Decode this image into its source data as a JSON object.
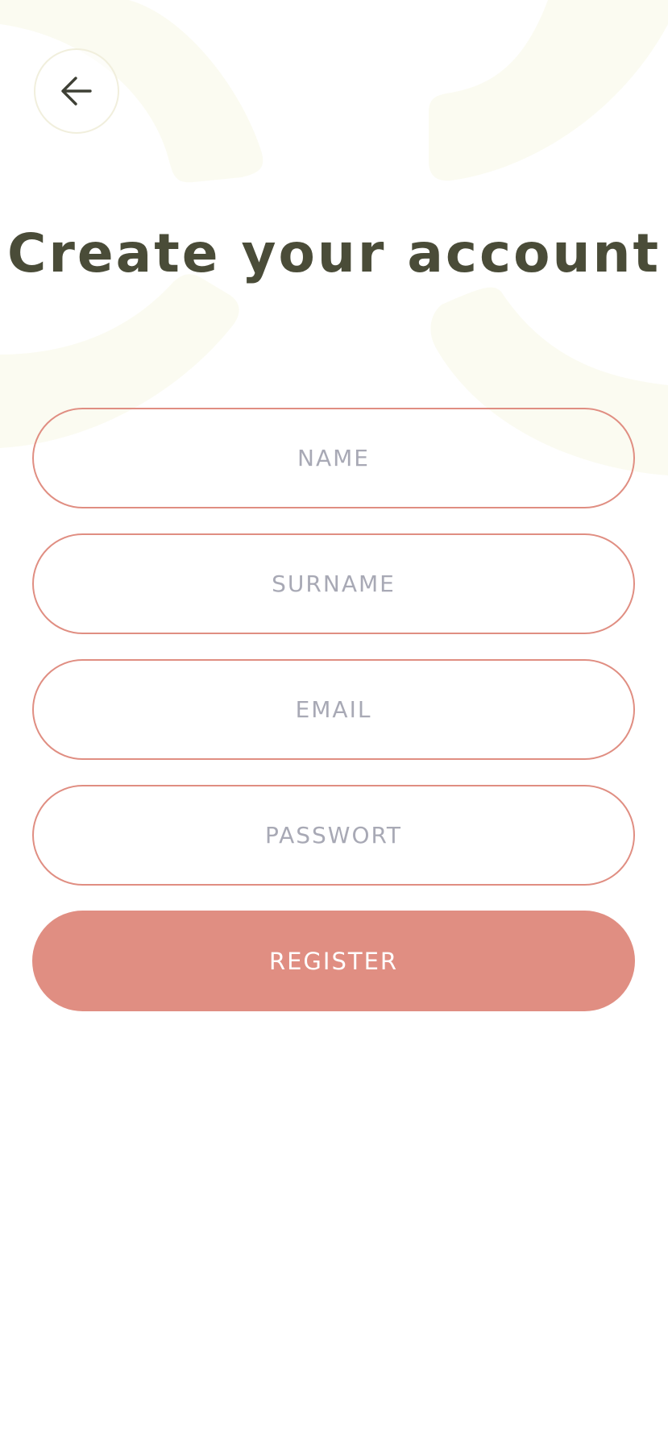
{
  "header": {
    "back_icon": "arrow-left-icon",
    "title": "Create your account"
  },
  "form": {
    "name_placeholder": "NAME",
    "surname_placeholder": "SURNAME",
    "email_placeholder": "EMAIL",
    "password_placeholder": "PASSWORT",
    "register_label": "REGISTER"
  },
  "colors": {
    "accent": "#e08e82",
    "title": "#4a4c38",
    "placeholder": "#a8a9b5",
    "decoration": "#fbfbf1"
  }
}
